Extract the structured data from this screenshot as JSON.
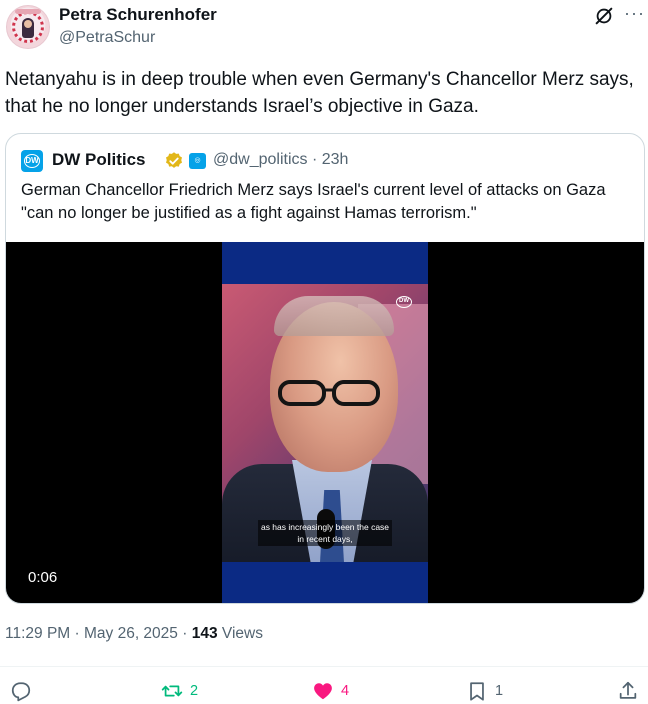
{
  "author": {
    "display_name": "Petra Schurenhofer",
    "handle": "@PetraSchur",
    "avatar_icon": "profile-avatar"
  },
  "tweet": {
    "text": "Netanyahu is in deep trouble when even Germany's Chancellor Merz says, that he no longer understands Israel’s objective in Gaza."
  },
  "quote": {
    "logo_text": "DW",
    "display_name": "DW Politics",
    "handle_time": "@dw_politics · 23h",
    "text": "German Chancellor Friedrich Merz says Israel's current level of attacks on Gaza \"can no longer be justified as a fight against Hamas terrorism.\"",
    "video": {
      "watermark": "DW",
      "subtitle_line1": "as has increasingly been the case",
      "subtitle_line2": "in recent days,",
      "duration": "0:06"
    }
  },
  "meta": {
    "time": "11:29 PM",
    "date": "May 26, 2025",
    "views_count": "143",
    "views_label": "Views"
  },
  "actions": {
    "replies": "",
    "retweets": "2",
    "likes": "4",
    "bookmarks": "1"
  },
  "colors": {
    "text": "#0f1419",
    "muted": "#536471",
    "retweet": "#00ba7c",
    "like": "#f91880",
    "dw_blue": "#05a2e8",
    "verified_gold": "#e2b719"
  }
}
